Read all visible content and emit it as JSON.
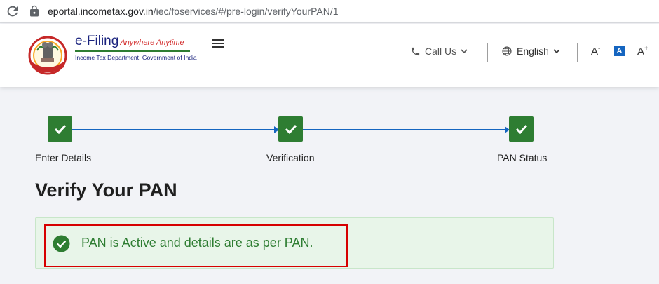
{
  "browser": {
    "url_host": "eportal.incometax.gov.in",
    "url_path": "/iec/foservices/#/pre-login/verifyYourPAN/1"
  },
  "header": {
    "logo_title": "e-Filing",
    "logo_tagline": "Anywhere Anytime",
    "logo_subtitle": "Income Tax Department, Government of India",
    "call_us": "Call Us",
    "language": "English",
    "font_decrease": "A",
    "font_default": "A",
    "font_increase": "A",
    "font_decrease_sup": "-",
    "font_increase_sup": "+"
  },
  "stepper": {
    "steps": [
      {
        "label": "Enter Details",
        "status": "completed"
      },
      {
        "label": "Verification",
        "status": "completed"
      },
      {
        "label": "PAN Status",
        "status": "completed"
      }
    ]
  },
  "page": {
    "title": "Verify Your PAN",
    "alert_message": "PAN is Active and details are as per PAN."
  },
  "colors": {
    "success_green": "#2e7d32",
    "alert_bg": "#e8f5e9",
    "accent_blue": "#1565c0",
    "highlight_red": "#d60000"
  }
}
